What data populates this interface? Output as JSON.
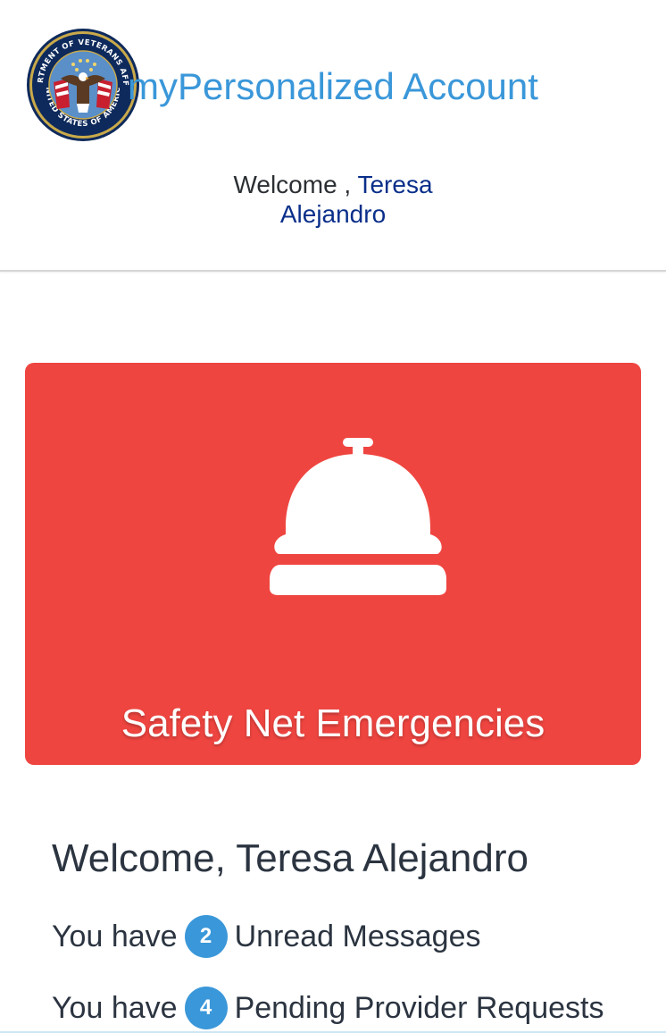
{
  "header": {
    "app_title": "myPersonalized Account",
    "welcome_prefix": "Welcome ,",
    "user_first_name": "Teresa",
    "user_last_name": "Alejandro",
    "seal": {
      "icon": "va-seal-icon",
      "top_text": "DEPARTMENT OF VETERANS AFFAIRS",
      "bottom_text": "UNITED STATES OF AMERICA"
    }
  },
  "emergency_card": {
    "label": "Safety Net Emergencies",
    "icon": "service-bell-icon",
    "color": "#ef4540"
  },
  "welcome_section": {
    "heading": "Welcome, Teresa Alejandro",
    "messages": {
      "prefix": "You have",
      "count": "2",
      "suffix": "Unread Messages"
    },
    "requests": {
      "prefix": "You have",
      "count": "4",
      "suffix": "Pending Provider Requests"
    }
  },
  "colors": {
    "accent": "#3a97d9",
    "name_link": "#0a2f8a",
    "emergency": "#ef4540",
    "text": "#2b3440"
  }
}
